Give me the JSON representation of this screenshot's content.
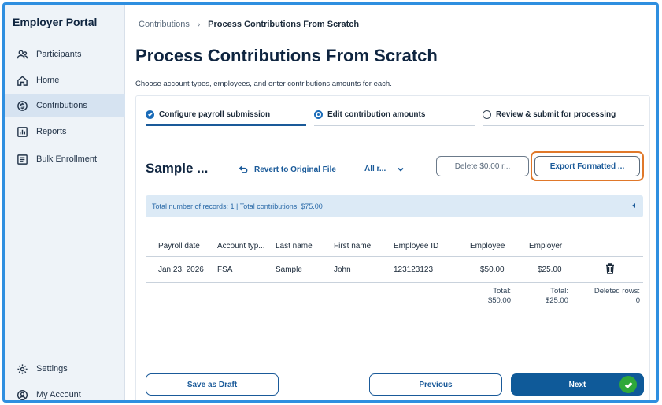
{
  "sidebar": {
    "brand": "Employer Portal",
    "items": [
      {
        "label": "Participants",
        "icon": "people-icon"
      },
      {
        "label": "Home",
        "icon": "home-icon"
      },
      {
        "label": "Contributions",
        "icon": "dollar-icon",
        "active": true
      },
      {
        "label": "Reports",
        "icon": "chart-icon"
      },
      {
        "label": "Bulk Enrollment",
        "icon": "list-icon"
      }
    ],
    "bottom_items": [
      {
        "label": "Settings",
        "icon": "gear-icon"
      },
      {
        "label": "My Account",
        "icon": "account-icon"
      }
    ]
  },
  "breadcrumb": {
    "parent": "Contributions",
    "current": "Process Contributions From Scratch"
  },
  "page": {
    "title": "Process Contributions From Scratch",
    "subtitle": "Choose account types, employees, and enter contributions amounts for each."
  },
  "stepper": {
    "steps": [
      {
        "label": "Configure payroll submission",
        "state": "complete"
      },
      {
        "label": "Edit contribution amounts",
        "state": "current"
      },
      {
        "label": "Review & submit for processing",
        "state": "pending"
      }
    ]
  },
  "toolbar": {
    "file_title": "Sample ...",
    "revert_label": "Revert to Original File",
    "filter_label": "All r...",
    "delete_label": "Delete $0.00 r...",
    "export_label": "Export Formatted ..."
  },
  "summary": {
    "text": "Total number of records: 1 | Total contributions: $75.00"
  },
  "table": {
    "columns": [
      "Payroll date",
      "Account typ...",
      "Last name",
      "First name",
      "Employee ID",
      "Employee",
      "Employer"
    ],
    "rows": [
      [
        "Jan 23, 2026",
        "FSA",
        "Sample",
        "John",
        "123123123",
        "$50.00",
        "$25.00"
      ]
    ],
    "totals": {
      "employee_label": "Total:",
      "employee_value": "$50.00",
      "employer_label": "Total:",
      "employer_value": "$25.00",
      "deleted_label": "Deleted rows:",
      "deleted_value": "0"
    }
  },
  "footer": {
    "save_draft": "Save as Draft",
    "previous": "Previous",
    "next": "Next"
  },
  "colors": {
    "accent": "#1a5a99",
    "highlight": "#e0782a",
    "success": "#2fa83a"
  }
}
